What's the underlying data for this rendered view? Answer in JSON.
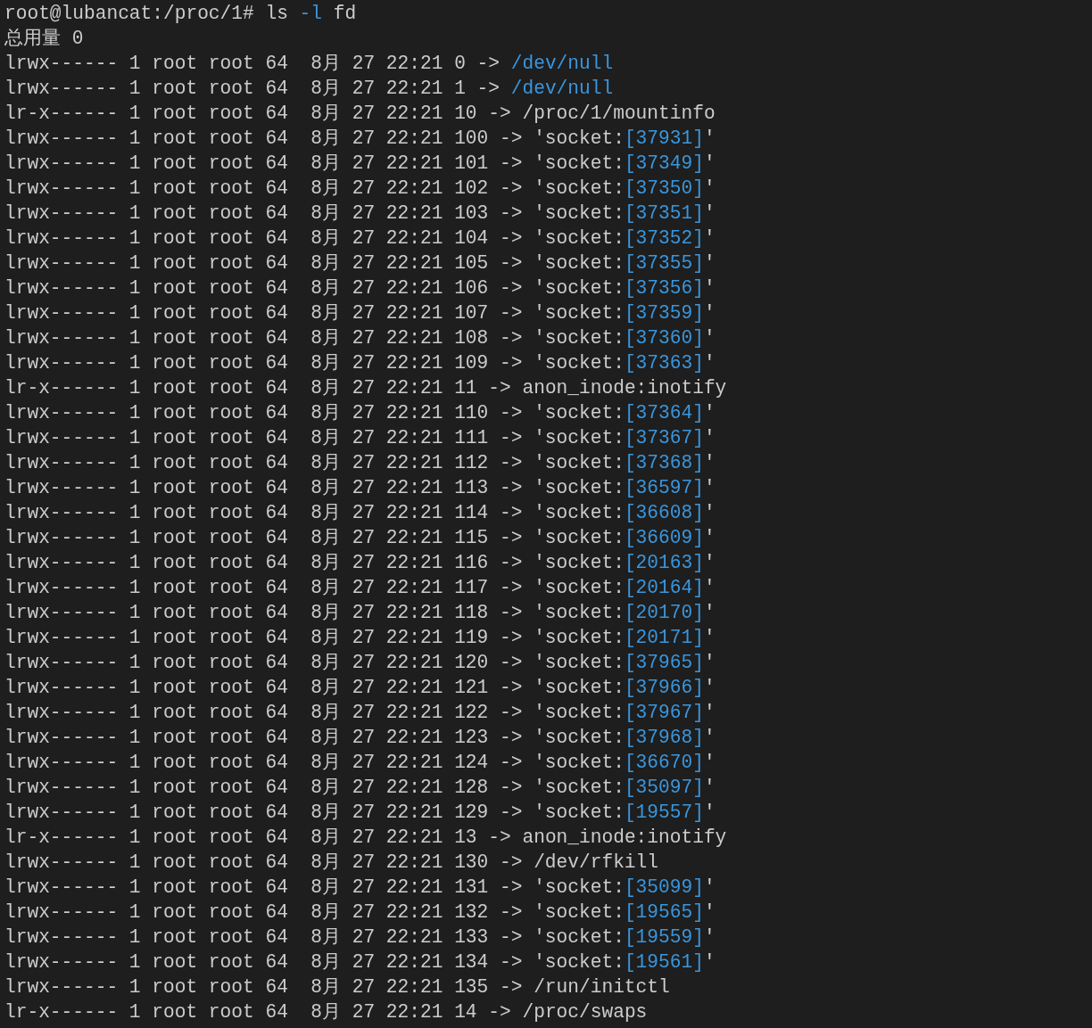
{
  "prompt": {
    "host": "root@lubancat:/proc/1#",
    "command": "ls",
    "option": "-l",
    "argument": "fd"
  },
  "total": "总用量 0",
  "entries": [
    {
      "meta": "lrwx------ 1 root root 64  8月 27 22:21",
      "fd": "0",
      "arrow": "->",
      "kind": "device",
      "target": "/dev/null"
    },
    {
      "meta": "lrwx------ 1 root root 64  8月 27 22:21",
      "fd": "1",
      "arrow": "->",
      "kind": "device",
      "target": "/dev/null"
    },
    {
      "meta": "lr-x------ 1 root root 64  8月 27 22:21",
      "fd": "10",
      "arrow": "->",
      "kind": "plain",
      "target": "/proc/1/mountinfo"
    },
    {
      "meta": "lrwx------ 1 root root 64  8月 27 22:21",
      "fd": "100",
      "arrow": "->",
      "kind": "socket",
      "target": "'socket:",
      "inode": "[37931]",
      "end": "'"
    },
    {
      "meta": "lrwx------ 1 root root 64  8月 27 22:21",
      "fd": "101",
      "arrow": "->",
      "kind": "socket",
      "target": "'socket:",
      "inode": "[37349]",
      "end": "'"
    },
    {
      "meta": "lrwx------ 1 root root 64  8月 27 22:21",
      "fd": "102",
      "arrow": "->",
      "kind": "socket",
      "target": "'socket:",
      "inode": "[37350]",
      "end": "'"
    },
    {
      "meta": "lrwx------ 1 root root 64  8月 27 22:21",
      "fd": "103",
      "arrow": "->",
      "kind": "socket",
      "target": "'socket:",
      "inode": "[37351]",
      "end": "'"
    },
    {
      "meta": "lrwx------ 1 root root 64  8月 27 22:21",
      "fd": "104",
      "arrow": "->",
      "kind": "socket",
      "target": "'socket:",
      "inode": "[37352]",
      "end": "'"
    },
    {
      "meta": "lrwx------ 1 root root 64  8月 27 22:21",
      "fd": "105",
      "arrow": "->",
      "kind": "socket",
      "target": "'socket:",
      "inode": "[37355]",
      "end": "'"
    },
    {
      "meta": "lrwx------ 1 root root 64  8月 27 22:21",
      "fd": "106",
      "arrow": "->",
      "kind": "socket",
      "target": "'socket:",
      "inode": "[37356]",
      "end": "'"
    },
    {
      "meta": "lrwx------ 1 root root 64  8月 27 22:21",
      "fd": "107",
      "arrow": "->",
      "kind": "socket",
      "target": "'socket:",
      "inode": "[37359]",
      "end": "'"
    },
    {
      "meta": "lrwx------ 1 root root 64  8月 27 22:21",
      "fd": "108",
      "arrow": "->",
      "kind": "socket",
      "target": "'socket:",
      "inode": "[37360]",
      "end": "'"
    },
    {
      "meta": "lrwx------ 1 root root 64  8月 27 22:21",
      "fd": "109",
      "arrow": "->",
      "kind": "socket",
      "target": "'socket:",
      "inode": "[37363]",
      "end": "'"
    },
    {
      "meta": "lr-x------ 1 root root 64  8月 27 22:21",
      "fd": "11",
      "arrow": "->",
      "kind": "plain",
      "target": "anon_inode:inotify"
    },
    {
      "meta": "lrwx------ 1 root root 64  8月 27 22:21",
      "fd": "110",
      "arrow": "->",
      "kind": "socket",
      "target": "'socket:",
      "inode": "[37364]",
      "end": "'"
    },
    {
      "meta": "lrwx------ 1 root root 64  8月 27 22:21",
      "fd": "111",
      "arrow": "->",
      "kind": "socket",
      "target": "'socket:",
      "inode": "[37367]",
      "end": "'"
    },
    {
      "meta": "lrwx------ 1 root root 64  8月 27 22:21",
      "fd": "112",
      "arrow": "->",
      "kind": "socket",
      "target": "'socket:",
      "inode": "[37368]",
      "end": "'"
    },
    {
      "meta": "lrwx------ 1 root root 64  8月 27 22:21",
      "fd": "113",
      "arrow": "->",
      "kind": "socket",
      "target": "'socket:",
      "inode": "[36597]",
      "end": "'"
    },
    {
      "meta": "lrwx------ 1 root root 64  8月 27 22:21",
      "fd": "114",
      "arrow": "->",
      "kind": "socket",
      "target": "'socket:",
      "inode": "[36608]",
      "end": "'"
    },
    {
      "meta": "lrwx------ 1 root root 64  8月 27 22:21",
      "fd": "115",
      "arrow": "->",
      "kind": "socket",
      "target": "'socket:",
      "inode": "[36609]",
      "end": "'"
    },
    {
      "meta": "lrwx------ 1 root root 64  8月 27 22:21",
      "fd": "116",
      "arrow": "->",
      "kind": "socket",
      "target": "'socket:",
      "inode": "[20163]",
      "end": "'"
    },
    {
      "meta": "lrwx------ 1 root root 64  8月 27 22:21",
      "fd": "117",
      "arrow": "->",
      "kind": "socket",
      "target": "'socket:",
      "inode": "[20164]",
      "end": "'"
    },
    {
      "meta": "lrwx------ 1 root root 64  8月 27 22:21",
      "fd": "118",
      "arrow": "->",
      "kind": "socket",
      "target": "'socket:",
      "inode": "[20170]",
      "end": "'"
    },
    {
      "meta": "lrwx------ 1 root root 64  8月 27 22:21",
      "fd": "119",
      "arrow": "->",
      "kind": "socket",
      "target": "'socket:",
      "inode": "[20171]",
      "end": "'"
    },
    {
      "meta": "lrwx------ 1 root root 64  8月 27 22:21",
      "fd": "120",
      "arrow": "->",
      "kind": "socket",
      "target": "'socket:",
      "inode": "[37965]",
      "end": "'"
    },
    {
      "meta": "lrwx------ 1 root root 64  8月 27 22:21",
      "fd": "121",
      "arrow": "->",
      "kind": "socket",
      "target": "'socket:",
      "inode": "[37966]",
      "end": "'"
    },
    {
      "meta": "lrwx------ 1 root root 64  8月 27 22:21",
      "fd": "122",
      "arrow": "->",
      "kind": "socket",
      "target": "'socket:",
      "inode": "[37967]",
      "end": "'"
    },
    {
      "meta": "lrwx------ 1 root root 64  8月 27 22:21",
      "fd": "123",
      "arrow": "->",
      "kind": "socket",
      "target": "'socket:",
      "inode": "[37968]",
      "end": "'"
    },
    {
      "meta": "lrwx------ 1 root root 64  8月 27 22:21",
      "fd": "124",
      "arrow": "->",
      "kind": "socket",
      "target": "'socket:",
      "inode": "[36670]",
      "end": "'"
    },
    {
      "meta": "lrwx------ 1 root root 64  8月 27 22:21",
      "fd": "128",
      "arrow": "->",
      "kind": "socket",
      "target": "'socket:",
      "inode": "[35097]",
      "end": "'"
    },
    {
      "meta": "lrwx------ 1 root root 64  8月 27 22:21",
      "fd": "129",
      "arrow": "->",
      "kind": "socket",
      "target": "'socket:",
      "inode": "[19557]",
      "end": "'"
    },
    {
      "meta": "lr-x------ 1 root root 64  8月 27 22:21",
      "fd": "13",
      "arrow": "->",
      "kind": "plain",
      "target": "anon_inode:inotify"
    },
    {
      "meta": "lrwx------ 1 root root 64  8月 27 22:21",
      "fd": "130",
      "arrow": "->",
      "kind": "plain",
      "target": "/dev/rfkill"
    },
    {
      "meta": "lrwx------ 1 root root 64  8月 27 22:21",
      "fd": "131",
      "arrow": "->",
      "kind": "socket",
      "target": "'socket:",
      "inode": "[35099]",
      "end": "'"
    },
    {
      "meta": "lrwx------ 1 root root 64  8月 27 22:21",
      "fd": "132",
      "arrow": "->",
      "kind": "socket",
      "target": "'socket:",
      "inode": "[19565]",
      "end": "'"
    },
    {
      "meta": "lrwx------ 1 root root 64  8月 27 22:21",
      "fd": "133",
      "arrow": "->",
      "kind": "socket",
      "target": "'socket:",
      "inode": "[19559]",
      "end": "'"
    },
    {
      "meta": "lrwx------ 1 root root 64  8月 27 22:21",
      "fd": "134",
      "arrow": "->",
      "kind": "socket",
      "target": "'socket:",
      "inode": "[19561]",
      "end": "'"
    },
    {
      "meta": "lrwx------ 1 root root 64  8月 27 22:21",
      "fd": "135",
      "arrow": "->",
      "kind": "plain",
      "target": "/run/initctl"
    },
    {
      "meta": "lr-x------ 1 root root 64  8月 27 22:21",
      "fd": "14",
      "arrow": "->",
      "kind": "plain",
      "target": "/proc/swaps"
    }
  ]
}
